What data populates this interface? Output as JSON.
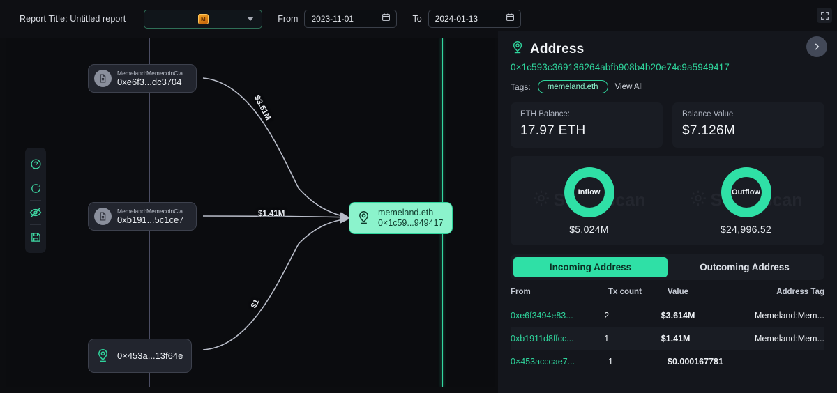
{
  "topbar": {
    "report_title": "Report Title: Untitled report",
    "chain_selector": {
      "icon": "token-icon",
      "glyph": "M",
      "caret": "chevron-down-icon"
    },
    "from_label": "From",
    "from_value": "2023-11-01",
    "to_label": "To",
    "to_value": "2024-01-13",
    "calendar_icon": "calendar-icon",
    "expand_icon": "fullscreen-expand-icon"
  },
  "graph": {
    "tools": [
      {
        "name": "help-icon",
        "glyph": "?"
      },
      {
        "name": "refresh-circle-icon",
        "glyph": "O"
      },
      {
        "name": "eye-off-icon",
        "glyph": "eye-slash"
      },
      {
        "name": "save-icon",
        "glyph": "floppy"
      }
    ],
    "nodes": [
      {
        "id": "a",
        "title": "Memeland:MemecoinCla...",
        "address": "0xe6f3...dc3704",
        "icon": "document-icon",
        "style": "gray"
      },
      {
        "id": "b",
        "title": "Memeland:MemecoinCla...",
        "address": "0xb191...5c1ce7",
        "icon": "document-icon",
        "style": "gray"
      },
      {
        "id": "c",
        "title": "",
        "address": "0×453a...13f64e",
        "icon": "address-pin-icon",
        "style": "dark"
      },
      {
        "id": "target",
        "title": "memeland.eth",
        "address": "0×1c59...949417",
        "icon": "address-pin-icon",
        "style": "green"
      }
    ],
    "edges": [
      {
        "from": "a",
        "to": "target",
        "label": "$3.61M"
      },
      {
        "from": "b",
        "to": "target",
        "label": "$1.41M"
      },
      {
        "from": "c",
        "to": "target",
        "label": "$1"
      }
    ]
  },
  "panel": {
    "icon": "address-pin-icon",
    "title": "Address",
    "hash": "0×1c593c369136264abfb908b4b20e74c9a5949417",
    "tags_label": "Tags:",
    "tag": "memeland.eth",
    "view_all": "View All",
    "collapse_icon": "chevron-right-icon",
    "cards": [
      {
        "label": "ETH Balance:",
        "value": "17.97 ETH"
      },
      {
        "label": "Balance Value",
        "value": "$7.126M"
      }
    ],
    "watermark": "Scopescan",
    "flows": [
      {
        "label": "Inflow",
        "amount": "$5.024M"
      },
      {
        "label": "Outflow",
        "amount": "$24,996.52"
      }
    ],
    "tabs": [
      {
        "label": "Incoming Address",
        "active": true
      },
      {
        "label": "Outcoming Address",
        "active": false
      }
    ],
    "table": {
      "columns": [
        "From",
        "Tx count",
        "Value",
        "Address Tag"
      ],
      "rows": [
        {
          "from": "0xe6f3494e83...",
          "tx": "2",
          "value": "$3.614M",
          "tag": "Memeland:Mem..."
        },
        {
          "from": "0xb1911d8ffcc...",
          "tx": "1",
          "value": "$1.41M",
          "tag": "Memeland:Mem..."
        },
        {
          "from": "0×453acccae7...",
          "tx": "1",
          "value": "$0.000167781",
          "tag": "-"
        }
      ]
    }
  },
  "colors": {
    "accent": "#2fe0a6",
    "accent_text": "#2fd49c",
    "panel_bg": "#14161c",
    "card_bg": "#191c23"
  }
}
